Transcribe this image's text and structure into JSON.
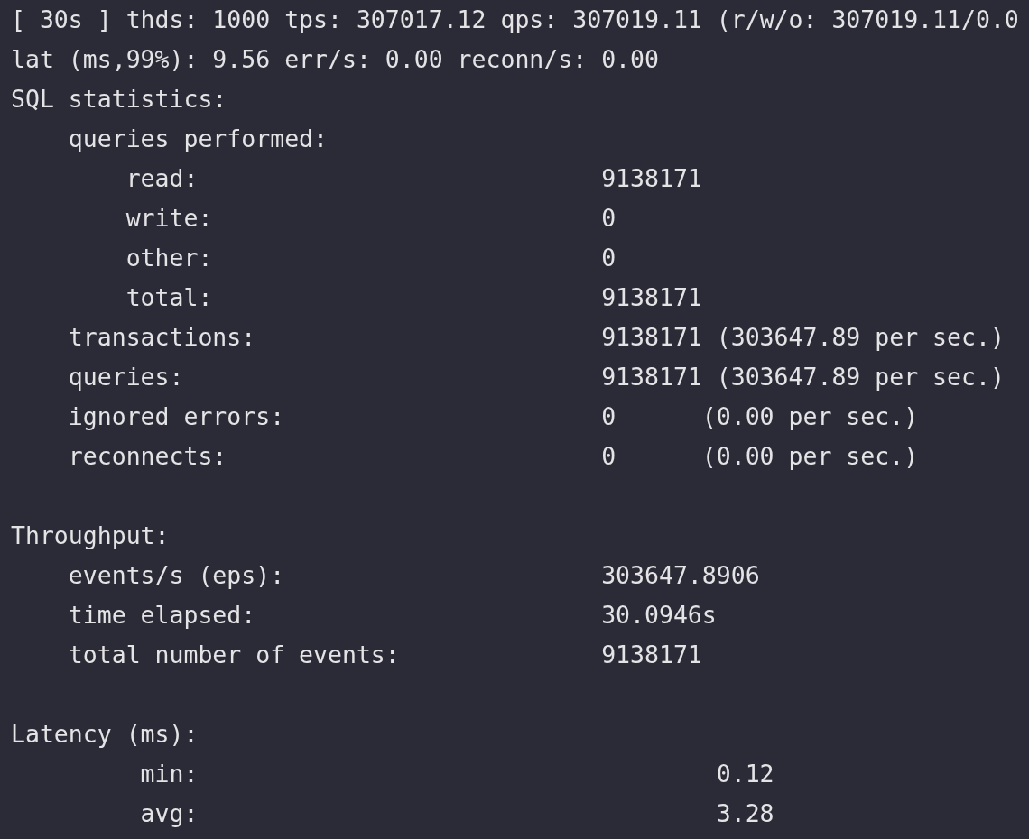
{
  "header_lines": [
    "[ 30s ] thds: 1000 tps: 307017.12 qps: 307019.11 (r/w/o: 307019.11/0.0",
    "lat (ms,99%): 9.56 err/s: 0.00 reconn/s: 0.00"
  ],
  "sections": [
    {
      "kind": "stats",
      "title": "SQL statistics:",
      "children": [
        {
          "label": "queries performed:",
          "children": [
            {
              "label": "read:",
              "value": "9138171"
            },
            {
              "label": "write:",
              "value": "0"
            },
            {
              "label": "other:",
              "value": "0"
            },
            {
              "label": "total:",
              "value": "9138171"
            }
          ]
        },
        {
          "label": "transactions:",
          "value": "9138171 (303647.89 per sec.)"
        },
        {
          "label": "queries:",
          "value": "9138171 (303647.89 per sec.)"
        },
        {
          "label": "ignored errors:",
          "value": "0      (0.00 per sec.)"
        },
        {
          "label": "reconnects:",
          "value": "0      (0.00 per sec.)"
        }
      ]
    },
    {
      "kind": "stats",
      "title": "Throughput:",
      "children": [
        {
          "label": "events/s (eps):",
          "value": "303647.8906"
        },
        {
          "label": "time elapsed:",
          "value": "30.0946s"
        },
        {
          "label": "total number of events:",
          "value": "9138171"
        }
      ]
    },
    {
      "kind": "latency",
      "title": "Latency (ms):",
      "children": [
        {
          "label": "min:",
          "value": "0.12"
        },
        {
          "label": "avg:",
          "value": "3.28"
        }
      ]
    }
  ]
}
